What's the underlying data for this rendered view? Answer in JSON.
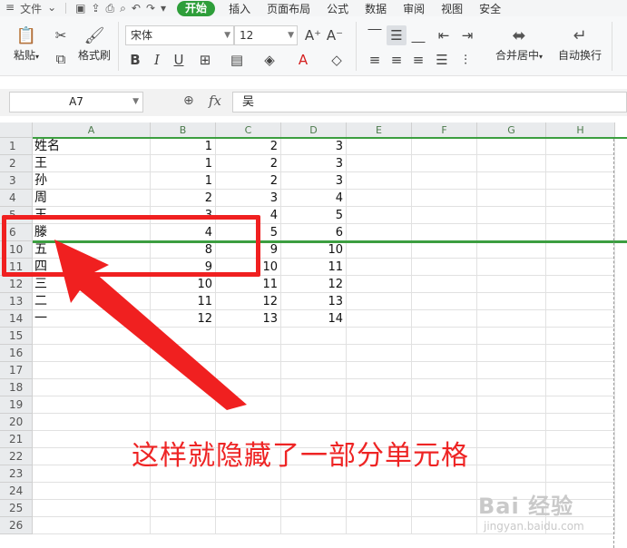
{
  "menubar": {
    "file_label": "文件",
    "items": [
      "开始",
      "插入",
      "页面布局",
      "公式",
      "数据",
      "审阅",
      "视图",
      "安全"
    ],
    "active_index": 0,
    "accent": "#2e9e3a"
  },
  "ribbon": {
    "paste_label": "粘贴",
    "format_painter_label": "格式刷",
    "font_name": "宋体",
    "font_size": "12",
    "merge_center_label": "合并居中",
    "wrap_text_label": "自动换行"
  },
  "formula_bar": {
    "cell_ref": "A7",
    "fx_label": "fx",
    "value": "吴"
  },
  "grid": {
    "columns": [
      "A",
      "B",
      "C",
      "D",
      "E",
      "F",
      "G",
      "H"
    ],
    "row_numbers": [
      "1",
      "2",
      "3",
      "4",
      "5",
      "6",
      "10",
      "11",
      "12",
      "13",
      "14",
      "15",
      "16",
      "17",
      "18",
      "19",
      "20",
      "21",
      "22",
      "23",
      "24",
      "25",
      "26"
    ],
    "rows": [
      [
        "姓名",
        "1",
        "2",
        "3"
      ],
      [
        "王",
        "1",
        "2",
        "3"
      ],
      [
        "孙",
        "1",
        "2",
        "3"
      ],
      [
        "周",
        "2",
        "3",
        "4"
      ],
      [
        "王",
        "3",
        "4",
        "5"
      ],
      [
        "滕",
        "4",
        "5",
        "6"
      ],
      [
        "五",
        "8",
        "9",
        "10"
      ],
      [
        "四",
        "9",
        "10",
        "11"
      ],
      [
        "三",
        "10",
        "11",
        "12"
      ],
      [
        "二",
        "11",
        "12",
        "13"
      ],
      [
        "一",
        "12",
        "13",
        "14"
      ]
    ]
  },
  "annotation": {
    "text": "这样就隐藏了一部分单元格",
    "color": "#ee2424"
  },
  "watermark": {
    "main": "Bai 经验",
    "sub": "jingyan.baidu.com"
  }
}
